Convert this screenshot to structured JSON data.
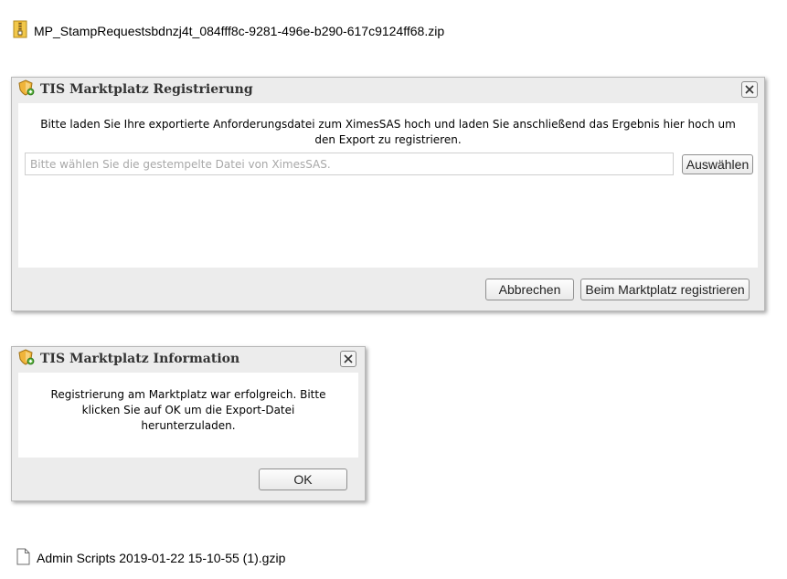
{
  "files": {
    "zip": {
      "name": "MP_StampRequestsbdnzj4t_084fff8c-9281-496e-b290-617c9124ff68.zip",
      "icon": "zip-file-icon"
    },
    "gzip": {
      "name": "Admin Scripts 2019-01-22 15-10-55 (1).gzip",
      "icon": "document-file-icon"
    }
  },
  "registration_dialog": {
    "title": "TIS Marktplatz Registrierung",
    "message": "Bitte laden Sie Ihre exportierte Anforderungsdatei zum XimesSAS hoch und laden Sie anschließend das Ergebnis hier hoch um den Export zu registrieren.",
    "file_input": {
      "value": "",
      "placeholder": "Bitte wählen Sie die gestempelte Datei von XimesSAS."
    },
    "choose_label": "Auswählen",
    "cancel_label": "Abbrechen",
    "register_label": "Beim Marktplatz registrieren"
  },
  "information_dialog": {
    "title": "TIS Marktplatz Information",
    "message": "Registrierung am Marktplatz war erfolgreich. Bitte klicken Sie auf OK um die Export-Datei herunterzuladen.",
    "ok_label": "OK"
  },
  "colors": {
    "dialog_frame": "#ececec",
    "dialog_body": "#ffffff",
    "title_text": "#333333",
    "placeholder_text": "#a8a8a8"
  }
}
